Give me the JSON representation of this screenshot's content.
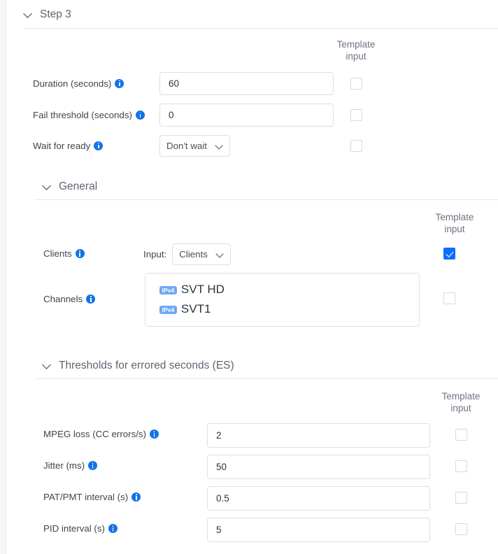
{
  "sections": [
    {
      "id": "step3",
      "title": "Step 3",
      "chevron_icon": "chevron-down-icon",
      "template_input_header": "Template\ninput",
      "template_input_header_line1": "Template",
      "template_input_header_line2": "input"
    },
    {
      "id": "general",
      "title": "General",
      "chevron_icon": "chevron-down-icon"
    },
    {
      "id": "thresholds",
      "title": "Thresholds for errored seconds (ES)",
      "chevron_icon": "chevron-down-icon"
    }
  ],
  "template_input": {
    "line1": "Template",
    "line2": "input"
  },
  "step3": {
    "title": "Step 3",
    "fields": [
      {
        "label": "Duration (seconds)",
        "info_icon": "info-icon",
        "type": "text",
        "value": "60",
        "template_input_checked": false
      },
      {
        "label": "Fail threshold (seconds)",
        "info_icon": "info-icon",
        "type": "text",
        "value": "0",
        "template_input_checked": false
      },
      {
        "label": "Wait for ready",
        "info_icon": "info-icon",
        "type": "select",
        "value": "Don't wait",
        "caret_icon": "chevron-down-icon",
        "template_input_checked": false
      }
    ]
  },
  "general": {
    "title": "General",
    "clients": {
      "label": "Clients",
      "info_icon": "info-icon",
      "input_prefix": "Input:",
      "select_value": "Clients",
      "caret_icon": "chevron-down-icon",
      "template_input_checked": true
    },
    "channels": {
      "label": "Channels",
      "info_icon": "info-icon",
      "template_input_checked": false,
      "items": [
        {
          "badge": "IPv4",
          "name": "SVT HD"
        },
        {
          "badge": "IPv4",
          "name": "SVT1"
        }
      ]
    }
  },
  "thresholds": {
    "title": "Thresholds for errored seconds (ES)",
    "fields": [
      {
        "label": "MPEG loss (CC errors/s)",
        "info_icon": "info-icon",
        "value": "2",
        "template_input_checked": false
      },
      {
        "label": "Jitter (ms)",
        "info_icon": "info-icon",
        "value": "50",
        "template_input_checked": false
      },
      {
        "label": "PAT/PMT interval (s)",
        "info_icon": "info-icon",
        "value": "0.5",
        "template_input_checked": false
      },
      {
        "label": "PID interval (s)",
        "info_icon": "info-icon",
        "value": "5",
        "template_input_checked": false
      }
    ]
  },
  "colors": {
    "accent": "#0d6efd",
    "info_icon": "#1473e6",
    "badge": "#6fa8f2",
    "border": "#dcdfe3",
    "divider": "#e6e7ea",
    "label_text": "#3d4550",
    "muted_text": "#6b7480"
  }
}
